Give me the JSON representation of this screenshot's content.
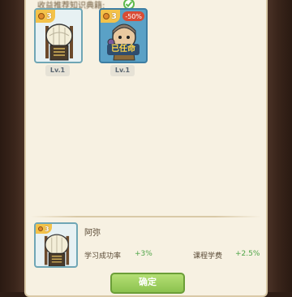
{
  "prompt": "收益推荐知识典籍:",
  "heroes": [
    {
      "star": "3",
      "level": "Lv.1",
      "pct": "",
      "status": ""
    },
    {
      "star": "3",
      "level": "Lv.1",
      "pct": "-50%",
      "status": "已任命"
    }
  ],
  "selected": {
    "star": "3",
    "name": "阿弥",
    "stat1": {
      "label": "学习成功率",
      "value": "+3%"
    },
    "stat2": {
      "label": "课程学费",
      "value": "+2.5%"
    }
  },
  "confirm_label": "确定",
  "colors": {
    "accent_green": "#8cc24f",
    "panel": "#f7f1e2",
    "positive": "#4fa548"
  }
}
